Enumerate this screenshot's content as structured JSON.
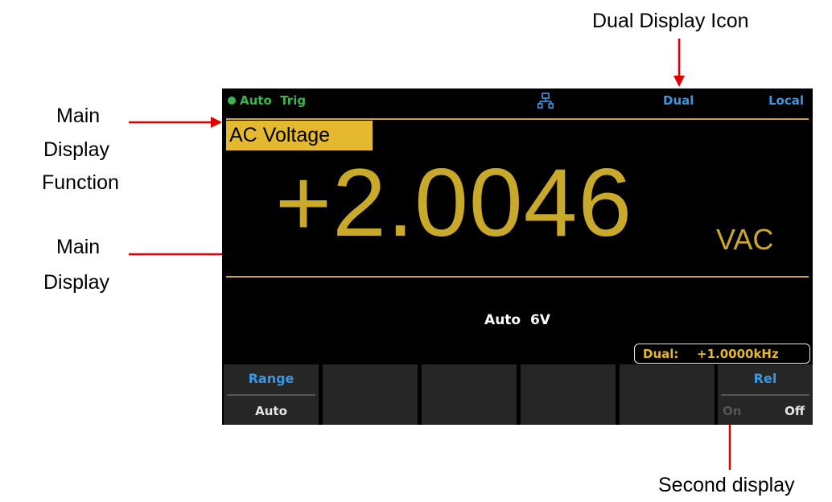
{
  "annotations": {
    "dual_display_icon": "Dual Display Icon",
    "main_display_function": [
      "Main",
      "Display",
      "Function"
    ],
    "main_display": [
      "Main",
      "Display"
    ],
    "second_display": "Second display",
    "arrow_color": "#e00000"
  },
  "screen": {
    "status": {
      "trigger": "Auto  Trig",
      "dual": "Dual",
      "local": "Local",
      "network_icon": "network-icon"
    },
    "function": "AC Voltage",
    "reading": "+2.0046",
    "unit": "VAC",
    "range_info": "Auto  6V",
    "second_display": {
      "label": "Dual:",
      "value": "+1.0000kHz"
    },
    "softkeys": {
      "range_title": "Range",
      "range_value": "Auto",
      "rel_title": "Rel",
      "rel_on": "On",
      "rel_off": "Off"
    },
    "colors": {
      "accent_yellow": "#e4b930",
      "reading_color": "#c9a92a",
      "status_blue": "#3b97e0",
      "trigger_green": "#3cb44b"
    }
  }
}
